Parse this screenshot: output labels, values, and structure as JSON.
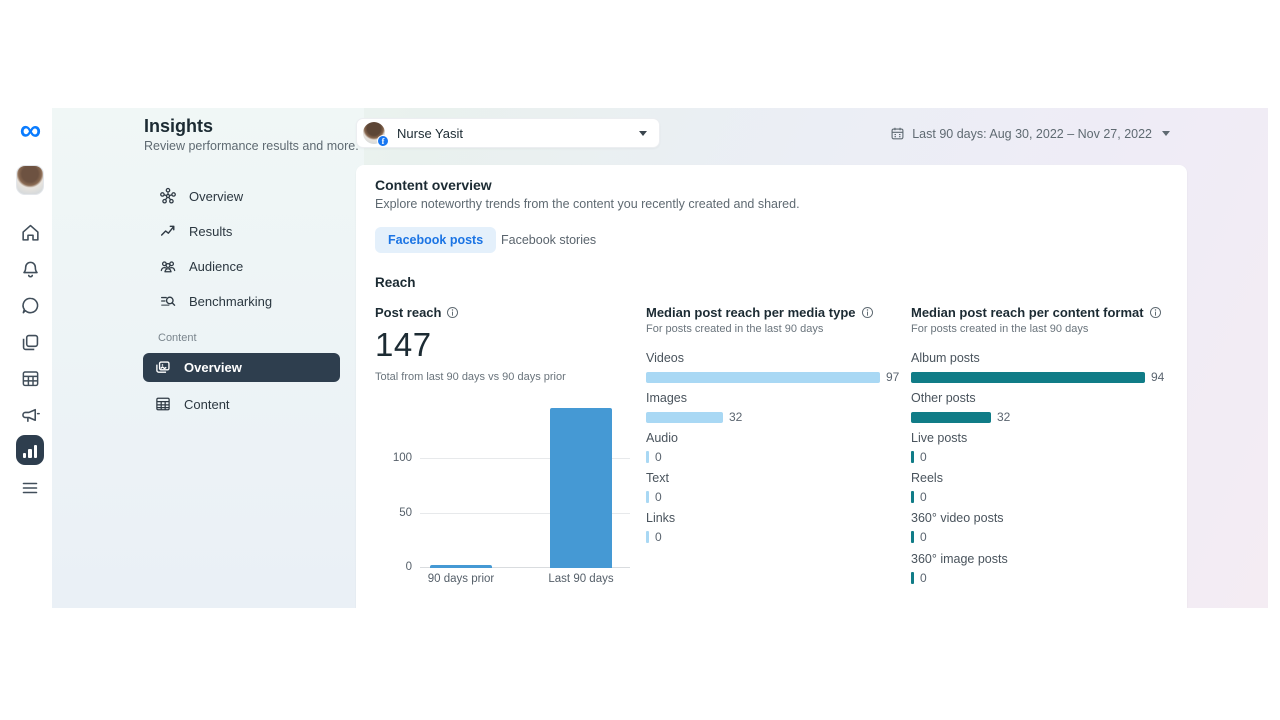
{
  "colors": {
    "accent_blue": "#1b74e4",
    "bar_blue": "#4599d4",
    "bar_light_blue": "#a9d8f4",
    "bar_teal": "#107c87",
    "selected_pill": "#2e3e4e",
    "meta_blue": "#0a7cff"
  },
  "rail": {
    "logo": "meta",
    "items": [
      "home",
      "notifications",
      "inbox",
      "posts",
      "planner",
      "ads",
      "insights",
      "all-tools"
    ]
  },
  "sidebar": {
    "title": "Insights",
    "subtitle": "Review performance results and more.",
    "items": [
      {
        "label": "Overview"
      },
      {
        "label": "Results"
      },
      {
        "label": "Audience"
      },
      {
        "label": "Benchmarking"
      }
    ],
    "section_label": "Content",
    "content_items": [
      {
        "label": "Overview",
        "selected": true
      },
      {
        "label": "Content",
        "selected": false
      }
    ]
  },
  "topbar": {
    "page_name": "Nurse Yasit",
    "date_range": "Last 90 days: Aug 30, 2022 – Nov 27, 2022"
  },
  "card": {
    "title": "Content overview",
    "subtitle": "Explore noteworthy trends from the content you recently created and shared.",
    "tabs": [
      {
        "label": "Facebook posts",
        "active": true
      },
      {
        "label": "Facebook stories",
        "active": false
      }
    ],
    "reach_heading": "Reach"
  },
  "chart_data": [
    {
      "type": "bar",
      "title": "Post reach",
      "value_total": "147",
      "caption": "Total from last 90 days vs 90 days prior",
      "categories": [
        "90 days prior",
        "Last 90 days"
      ],
      "values": [
        3,
        147
      ],
      "yticks": [
        0,
        50,
        100
      ],
      "ylim": [
        0,
        147
      ],
      "scale_max": 147,
      "grid": true,
      "legend": "none",
      "color": "#4599d4"
    },
    {
      "type": "bar-horizontal",
      "title": "Median post reach per media type",
      "subtitle": "For posts created in the last 90 days",
      "rows": [
        {
          "label": "Videos",
          "value": 97
        },
        {
          "label": "Images",
          "value": 32
        },
        {
          "label": "Audio",
          "value": 0
        },
        {
          "label": "Text",
          "value": 0
        },
        {
          "label": "Links",
          "value": 0
        }
      ],
      "max": 97,
      "color": "#a9d8f4"
    },
    {
      "type": "bar-horizontal",
      "title": "Median post reach per content format",
      "subtitle": "For posts created in the last 90 days",
      "rows": [
        {
          "label": "Album posts",
          "value": 94
        },
        {
          "label": "Other posts",
          "value": 32
        },
        {
          "label": "Live posts",
          "value": 0
        },
        {
          "label": "Reels",
          "value": 0
        },
        {
          "label": "360° video posts",
          "value": 0
        },
        {
          "label": "360° image posts",
          "value": 0
        }
      ],
      "max": 94,
      "color": "#107c87"
    }
  ]
}
